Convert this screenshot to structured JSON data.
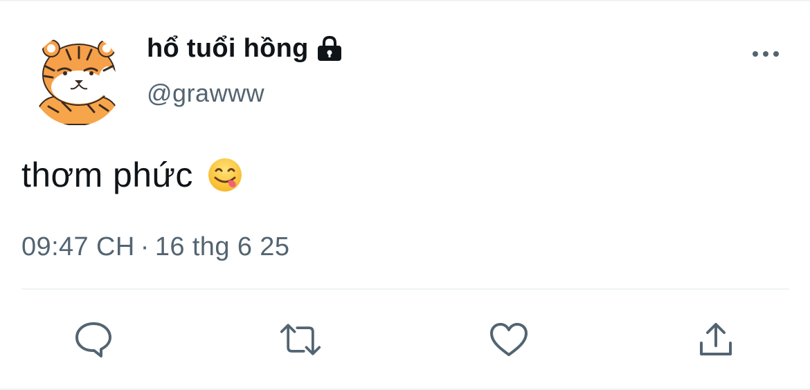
{
  "tweet": {
    "author": {
      "display_name": "hổ tuổi hồng",
      "handle": "@grawww",
      "protected": true,
      "avatar_icon": "tiger-avatar"
    },
    "text": "thơm phức",
    "emoji": "face-savoring-food",
    "timestamp": {
      "time": "09:47 CH",
      "separator": "·",
      "date": "16 thg 6 25"
    }
  },
  "icons": {
    "more": "more-icon",
    "reply": "reply-icon",
    "retweet": "retweet-icon",
    "like": "like-icon",
    "share": "share-icon",
    "lock": "lock-icon"
  },
  "colors": {
    "text_primary": "#0f1419",
    "text_secondary": "#536471",
    "divider": "#eff3f4",
    "background": "#ffffff"
  }
}
